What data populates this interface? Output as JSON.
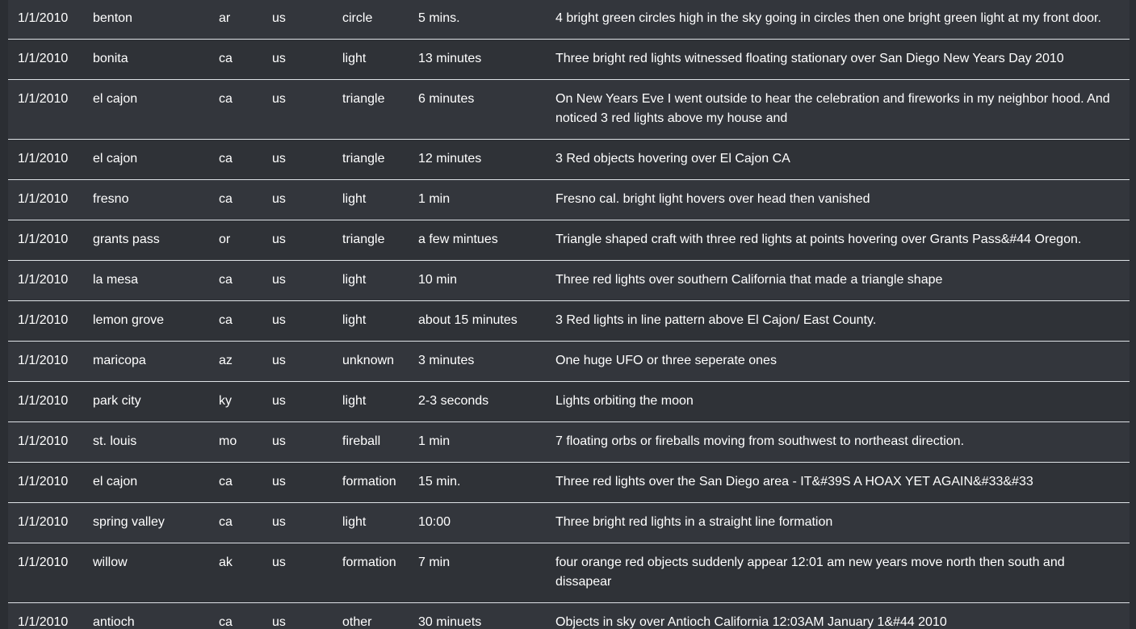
{
  "table": {
    "rows": [
      {
        "date": "1/1/2010",
        "city": "benton",
        "state": "ar",
        "country": "us",
        "shape": "circle",
        "duration": "5 mins.",
        "comment": "4 bright green circles high in the sky going in circles then one bright green light at my front door."
      },
      {
        "date": "1/1/2010",
        "city": "bonita",
        "state": "ca",
        "country": "us",
        "shape": "light",
        "duration": "13 minutes",
        "comment": "Three bright red lights witnessed floating stationary over San Diego New Years Day 2010"
      },
      {
        "date": "1/1/2010",
        "city": "el cajon",
        "state": "ca",
        "country": "us",
        "shape": "triangle",
        "duration": "6 minutes",
        "comment": "On New Years Eve I went outside to hear the celebration and fireworks in my neighbor hood. And noticed 3 red lights above my house and"
      },
      {
        "date": "1/1/2010",
        "city": "el cajon",
        "state": "ca",
        "country": "us",
        "shape": "triangle",
        "duration": "12 minutes",
        "comment": "3 Red objects hovering over El Cajon CA"
      },
      {
        "date": "1/1/2010",
        "city": "fresno",
        "state": "ca",
        "country": "us",
        "shape": "light",
        "duration": "1 min",
        "comment": "Fresno cal. bright light hovers over head then vanished"
      },
      {
        "date": "1/1/2010",
        "city": "grants pass",
        "state": "or",
        "country": "us",
        "shape": "triangle",
        "duration": "a few mintues",
        "comment": "Triangle shaped craft with three red lights at points hovering over Grants Pass&#44 Oregon."
      },
      {
        "date": "1/1/2010",
        "city": "la mesa",
        "state": "ca",
        "country": "us",
        "shape": "light",
        "duration": "10 min",
        "comment": "Three red lights over southern California that made a triangle shape"
      },
      {
        "date": "1/1/2010",
        "city": "lemon grove",
        "state": "ca",
        "country": "us",
        "shape": "light",
        "duration": "about 15 minutes",
        "comment": "3 Red lights in line pattern above El Cajon/ East County."
      },
      {
        "date": "1/1/2010",
        "city": "maricopa",
        "state": "az",
        "country": "us",
        "shape": "unknown",
        "duration": "3 minutes",
        "comment": "One huge UFO or three seperate ones"
      },
      {
        "date": "1/1/2010",
        "city": "park city",
        "state": "ky",
        "country": "us",
        "shape": "light",
        "duration": "2-3 seconds",
        "comment": "Lights orbiting the moon"
      },
      {
        "date": "1/1/2010",
        "city": "st. louis",
        "state": "mo",
        "country": "us",
        "shape": "fireball",
        "duration": "1 min",
        "comment": "7 floating orbs or fireballs moving from southwest to northeast direction."
      },
      {
        "date": "1/1/2010",
        "city": "el cajon",
        "state": "ca",
        "country": "us",
        "shape": "formation",
        "duration": "15 min.",
        "comment": "Three red lights over the San Diego area - IT&#39S A HOAX YET AGAIN&#33&#33"
      },
      {
        "date": "1/1/2010",
        "city": "spring valley",
        "state": "ca",
        "country": "us",
        "shape": "light",
        "duration": "10:00",
        "comment": "Three bright red lights in a straight line formation"
      },
      {
        "date": "1/1/2010",
        "city": "willow",
        "state": "ak",
        "country": "us",
        "shape": "formation",
        "duration": "7 min",
        "comment": "four orange red objects suddenly appear 12:01 am new years move north then south and dissapear"
      },
      {
        "date": "1/1/2010",
        "city": "antioch",
        "state": "ca",
        "country": "us",
        "shape": "other",
        "duration": "30 minuets",
        "comment": "Objects in sky over Antioch California 12:03AM January 1&#44 2010"
      }
    ]
  },
  "colors": {
    "background": "#2b2e33",
    "row_background": "#33363c",
    "row_alt_background": "#2f3237",
    "text": "#ffffff",
    "divider": "#dee2e6"
  }
}
